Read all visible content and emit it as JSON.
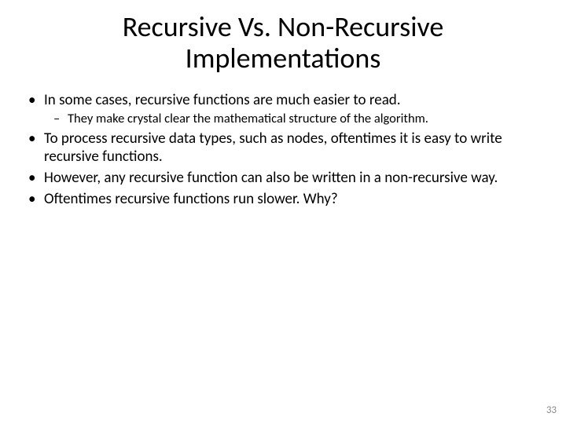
{
  "title": "Recursive Vs. Non-Recursive Implementations",
  "bullets": {
    "b1": "In some cases, recursive functions are much easier to read.",
    "b1a": "They make crystal clear the mathematical structure of the algorithm.",
    "b2": "To process recursive data types, such as nodes, oftentimes it is easy to write recursive functions.",
    "b3": "However, any recursive function can also be written in a non-recursive way.",
    "b4": "Oftentimes recursive functions run slower. Why?"
  },
  "page_number": "33"
}
